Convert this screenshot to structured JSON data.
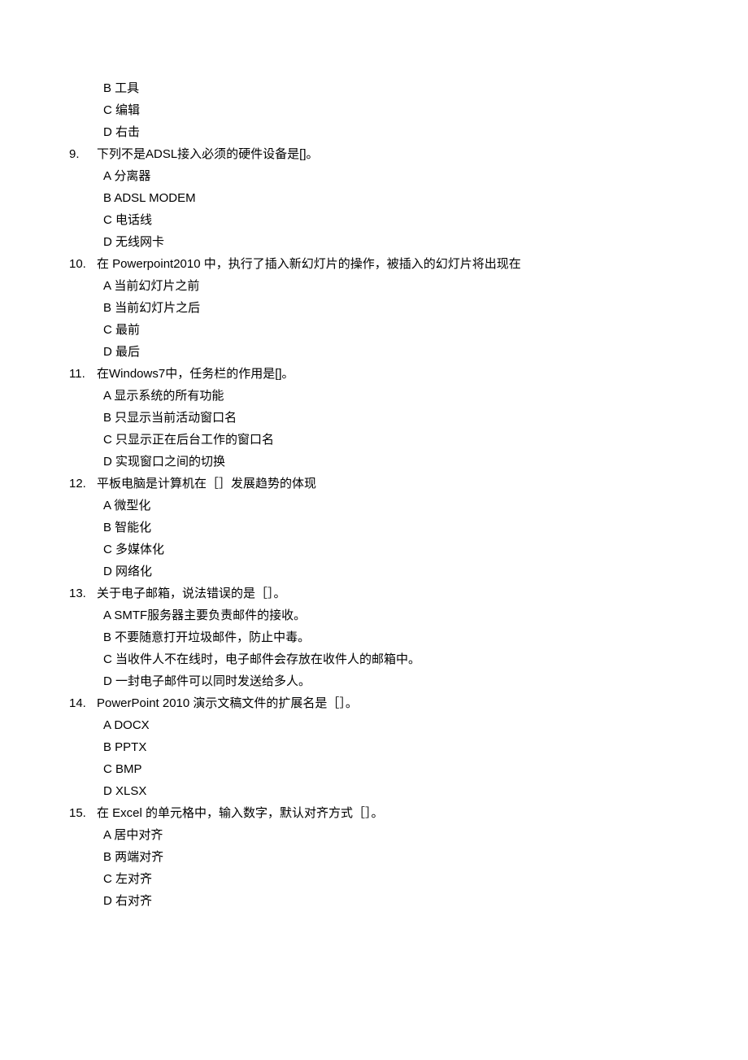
{
  "orphan_options": [
    "B 工具",
    "C 编辑",
    "D 右击"
  ],
  "questions": [
    {
      "num": "9.",
      "stem": "下列不是ADSL接入必须的硬件设备是[]。",
      "options": [
        "A 分离器",
        "B ADSL MODEM",
        "C 电话线",
        "D 无线网卡"
      ]
    },
    {
      "num": "10.",
      "stem": "在 Powerpoint2010 中，执行了插入新幻灯片的操作，被插入的幻灯片将出现在",
      "options": [
        "A 当前幻灯片之前",
        "B 当前幻灯片之后",
        "C 最前",
        "D 最后"
      ]
    },
    {
      "num": "11.",
      "stem": "在Windows7中，任务栏的作用是[]。",
      "options": [
        "A 显示系统的所有功能",
        "B 只显示当前活动窗口名",
        "C 只显示正在后台工作的窗口名",
        "D 实现窗口之间的切换"
      ]
    },
    {
      "num": "12.",
      "stem": "平板电脑是计算机在［］发展趋势的体现",
      "options": [
        "A 微型化",
        "B 智能化",
        "C 多媒体化",
        "D 网络化"
      ]
    },
    {
      "num": "13.",
      "stem": "关于电子邮箱，说法错误的是［］。",
      "options": [
        "A SMTF服务器主要负责邮件的接收。",
        "B 不要随意打开垃圾邮件，防止中毒。",
        "C 当收件人不在线时，电子邮件会存放在收件人的邮箱中。",
        "D 一封电子邮件可以同时发送给多人。"
      ]
    },
    {
      "num": "14.",
      "stem": "PowerPoint 2010 演示文稿文件的扩展名是［］。",
      "options": [
        "A DOCX",
        "B PPTX",
        "C BMP",
        "D XLSX"
      ]
    },
    {
      "num": "15.",
      "stem": "在 Excel 的单元格中，输入数字，默认对齐方式［］。",
      "options": [
        "A 居中对齐",
        "B 两端对齐",
        "C 左对齐",
        "D 右对齐"
      ]
    }
  ]
}
